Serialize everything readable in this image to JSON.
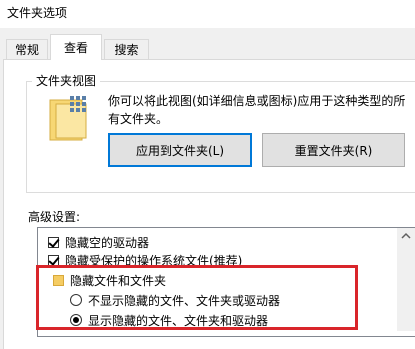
{
  "window": {
    "title": "文件夹选项"
  },
  "tabs": [
    {
      "label": "常规"
    },
    {
      "label": "查看"
    },
    {
      "label": "搜索"
    }
  ],
  "folder_view": {
    "group_title": "文件夹视图",
    "description": "你可以将此视图(如详细信息或图标)应用于这种类型的所有文件夹。",
    "apply_button": "应用到文件夹(L)",
    "reset_button": "重置文件夹(R)"
  },
  "advanced": {
    "label": "高级设置:",
    "items": [
      {
        "label": "隐藏空的驱动器",
        "type": "checkbox",
        "checked": true
      },
      {
        "label": "隐藏受保护的操作系统文件(推荐)",
        "type": "checkbox",
        "checked": true
      },
      {
        "label": "隐藏文件和文件夹",
        "type": "folder"
      },
      {
        "label": "不显示隐藏的文件、文件夹或驱动器",
        "type": "radio",
        "checked": false
      },
      {
        "label": "显示隐藏的文件、文件夹和驱动器",
        "type": "radio",
        "checked": true
      }
    ]
  },
  "colors": {
    "highlight": "#d9252a",
    "focus_border": "#0078d7"
  }
}
